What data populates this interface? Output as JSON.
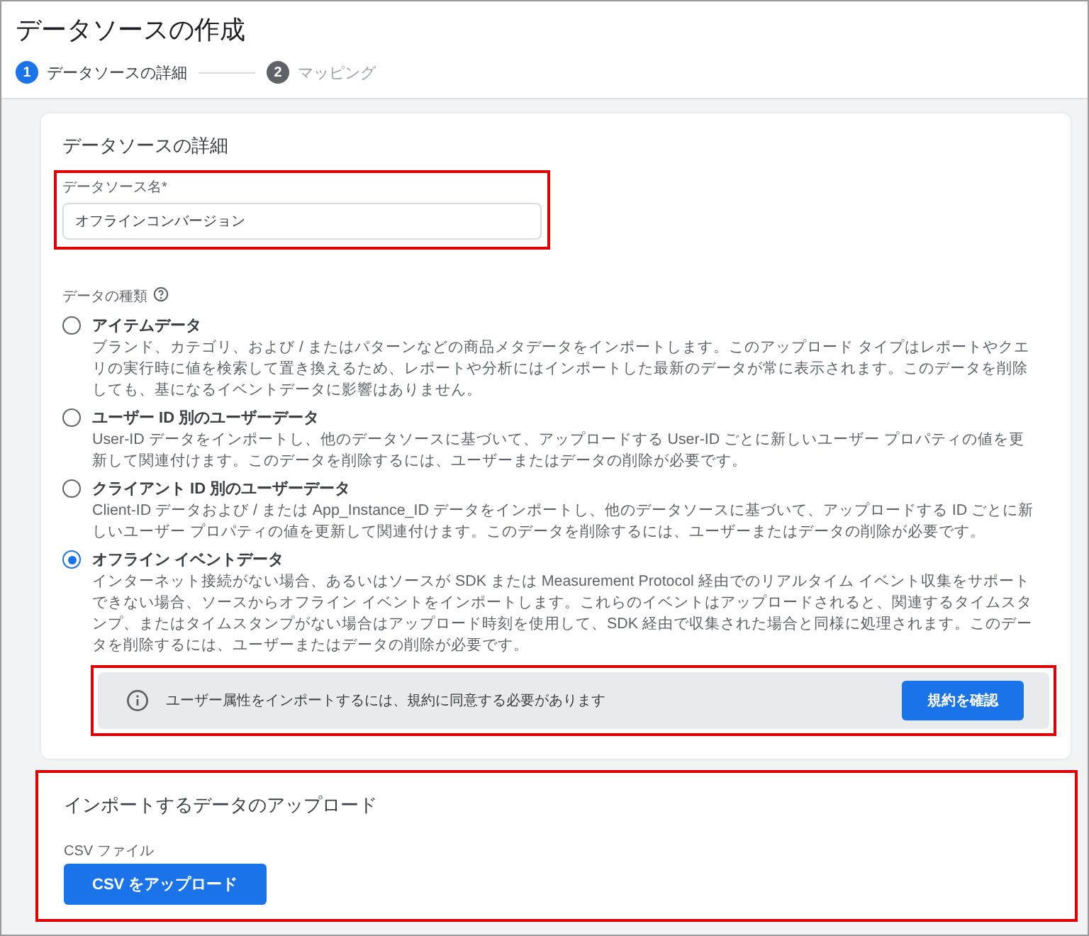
{
  "title": "データソースの作成",
  "steps": [
    {
      "number": "1",
      "label": "データソースの詳細",
      "selected": true
    },
    {
      "number": "2",
      "label": "マッピング",
      "selected": false
    }
  ],
  "details": {
    "heading": "データソースの詳細",
    "name_field": {
      "label": "データソース名*",
      "value": "オフラインコンバージョン",
      "highlighted": true
    },
    "type_label": "データの種類",
    "types": [
      {
        "label": "アイテムデータ",
        "description": "ブランド、カテゴリ、および / またはパターンなどの商品メタデータをインポートします。このアップロード タイプはレポートやクエリの実行時に値を検索して置き換えるため、レポートや分析にはインポートした最新のデータが常に表示されます。このデータを削除しても、基になるイベントデータに影響はありません。",
        "selected": false
      },
      {
        "label": "ユーザー ID 別のユーザーデータ",
        "description": "User-ID データをインポートし、他のデータソースに基づいて、アップロードする User-ID ごとに新しいユーザー プロパティの値を更新して関連付けます。このデータを削除するには、ユーザーまたはデータの削除が必要です。",
        "selected": false
      },
      {
        "label": "クライアント ID 別のユーザーデータ",
        "description": "Client-ID データおよび / または App_Instance_ID データをインポートし、他のデータソースに基づいて、アップロードする ID ごとに新しいユーザー プロパティの値を更新して関連付けます。このデータを削除するには、ユーザーまたはデータの削除が必要です。",
        "selected": false
      },
      {
        "label": "オフライン イベントデータ",
        "description": "インターネット接続がない場合、あるいはソースが SDK または Measurement Protocol 経由でのリアルタイム イベント収集をサポートできない場合、ソースからオフライン イベントをインポートします。これらのイベントはアップロードされると、関連するタイムスタンプ、またはタイムスタンプがない場合はアップロード時刻を使用して、SDK 経由で収集された場合と同様に処理されます。このデータを削除するには、ユーザーまたはデータの削除が必要です。",
        "selected": true
      }
    ],
    "notice": {
      "text": "ユーザー属性をインポートするには、規約に同意する必要があります",
      "button": "規約を確認",
      "highlighted": true
    }
  },
  "upload": {
    "heading": "インポートするデータのアップロード",
    "file_label": "CSV ファイル",
    "button": "CSV をアップロード",
    "highlighted": true
  }
}
